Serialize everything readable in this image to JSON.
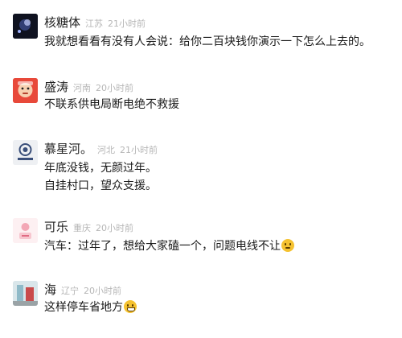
{
  "comments": [
    {
      "name": "核糖体",
      "location": "江苏",
      "time": "21小时前",
      "lines": [
        "我就想看看有没有人会说：给你二百块钱你演示一下怎么上去的。"
      ],
      "avatar": "dark-galaxy-avatar"
    },
    {
      "name": "盛涛",
      "location": "河南",
      "time": "20小时前",
      "lines": [
        "不联系供电局断电绝不救援"
      ],
      "avatar": "cartoon-face-avatar"
    },
    {
      "name": "慕星河。",
      "location": "河北",
      "time": "21小时前",
      "lines": [
        "年底没钱，无颜过年。",
        "自挂村口，望众支援。"
      ],
      "avatar": "logo-avatar"
    },
    {
      "name": "可乐",
      "location": "重庆",
      "time": "20小时前",
      "lines": [
        "汽车：过年了，想给大家磕一个，问题电线不让"
      ],
      "avatar": "pink-avatar",
      "emoji": "thinking-face-icon"
    },
    {
      "name": "海",
      "location": "辽宁",
      "time": "20小时前",
      "lines": [
        "这样停车省地方"
      ],
      "avatar": "photo-avatar",
      "emoji": "grinning-face-icon"
    }
  ]
}
